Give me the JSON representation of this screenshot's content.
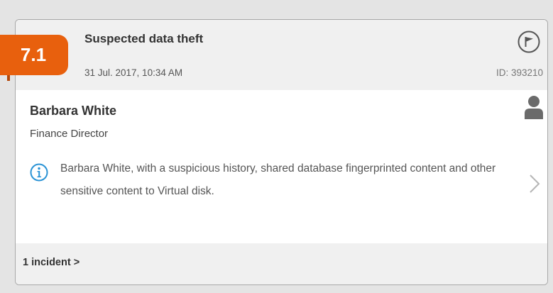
{
  "incident": {
    "score": "7.1",
    "title": "Suspected data theft",
    "date": "31 Jul. 2017, 10:34 AM",
    "id_label": "ID: 393210"
  },
  "user": {
    "name": "Barbara White",
    "role": "Finance Director"
  },
  "description": "Barbara White, with a suspicious history, shared database fingerprinted content and other sensitive content to Virtual disk.",
  "footer": {
    "incident_link": "1 incident >"
  },
  "icons": {
    "flag": "flag-icon",
    "user": "user-icon",
    "info": "info-icon",
    "chevron": "chevron-right-icon"
  },
  "colors": {
    "score_badge": "#e8600d",
    "info_icon": "#2a93d5",
    "header_bg": "#f0f0f0"
  }
}
